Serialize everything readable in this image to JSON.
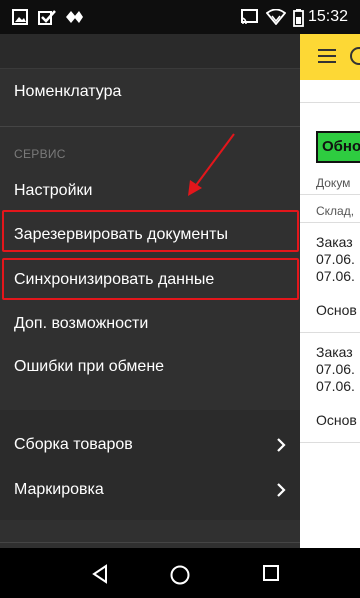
{
  "status_bar": {
    "time": "15:32",
    "icons_left": [
      "gallery-icon",
      "check-square-icon",
      "diamond-icon"
    ],
    "icons_right": [
      "cast-icon",
      "wifi-icon",
      "battery-icon"
    ]
  },
  "drawer": {
    "items_top": [
      {
        "label": "Номенклатура"
      }
    ],
    "section_header": "СЕРВИС",
    "service_items": [
      {
        "label": "Настройки"
      },
      {
        "label": "Зарезервировать документы",
        "highlighted": true
      },
      {
        "label": "Синхронизировать данные",
        "highlighted": true
      },
      {
        "label": "Доп. возможности"
      },
      {
        "label": "Ошибки при обмене"
      }
    ],
    "submenu_items": [
      {
        "label": "Сборка товаров",
        "icon": "chevron-right-icon"
      },
      {
        "label": "Маркировка",
        "icon": "chevron-right-icon"
      }
    ],
    "highlight_color": "#e3161b"
  },
  "app_background": {
    "refresh_label": "Обно",
    "header_doc": "Докум",
    "header_wh": "Склад,",
    "rows": [
      {
        "title": "Заказ",
        "date1": "07.06.",
        "date2": "07.06.",
        "status": "Основ"
      },
      {
        "title": "Заказ",
        "date1": "07.06.",
        "date2": "07.06.",
        "status": "Основ"
      }
    ],
    "accent_color": "#fdd835",
    "button_color": "#2ecc40"
  },
  "nav_bar": {
    "buttons": [
      "back-icon",
      "home-icon",
      "recents-icon"
    ]
  }
}
